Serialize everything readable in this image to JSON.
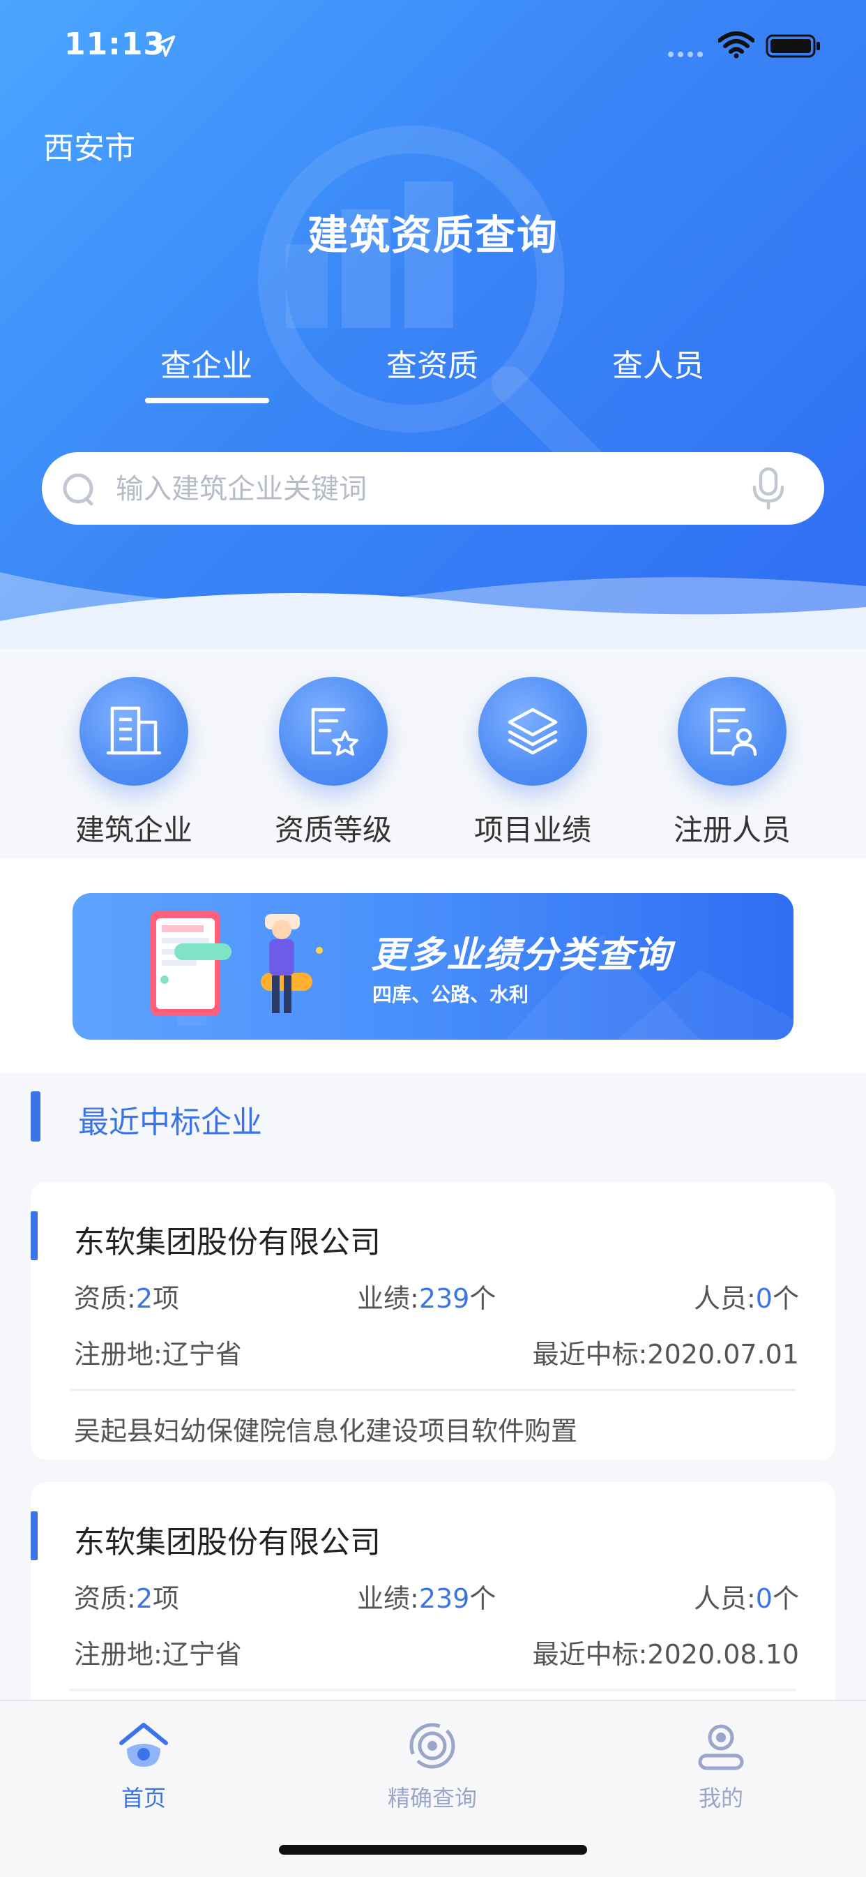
{
  "status_bar": {
    "time": "11:13"
  },
  "header": {
    "city": "西安市",
    "title": "建筑资质查询",
    "tabs": [
      {
        "label": "查企业",
        "active": true
      },
      {
        "label": "查资质",
        "active": false
      },
      {
        "label": "查人员",
        "active": false
      }
    ],
    "search": {
      "placeholder": "输入建筑企业关键词",
      "value": ""
    }
  },
  "quick_entries": [
    {
      "label": "建筑企业",
      "icon": "building-icon"
    },
    {
      "label": "资质等级",
      "icon": "certificate-star-icon"
    },
    {
      "label": "项目业绩",
      "icon": "layers-icon"
    },
    {
      "label": "注册人员",
      "icon": "person-card-icon"
    }
  ],
  "banner": {
    "title": "更多业绩分类查询",
    "subtitle": "四库、公路、水利"
  },
  "section": {
    "title": "最近中标企业"
  },
  "companies": [
    {
      "name": "东软集团股份有限公司",
      "qual_label": "资质:",
      "qual_value": "2",
      "qual_unit": "项",
      "perf_label": "业绩:",
      "perf_value": "239",
      "perf_unit": "个",
      "staff_label": "人员:",
      "staff_value": "0",
      "staff_unit": "个",
      "region": "注册地:辽宁省",
      "recent_bid": "最近中标:2020.07.01",
      "project": "吴起县妇幼保健院信息化建设项目软件购置"
    },
    {
      "name": "东软集团股份有限公司",
      "qual_label": "资质:",
      "qual_value": "2",
      "qual_unit": "项",
      "perf_label": "业绩:",
      "perf_value": "239",
      "perf_unit": "个",
      "staff_label": "人员:",
      "staff_value": "0",
      "staff_unit": "个",
      "region": "注册地:辽宁省",
      "recent_bid": "最近中标:2020.08.10",
      "project": ""
    }
  ],
  "bottom_nav": [
    {
      "label": "首页",
      "icon": "home-icon",
      "active": true
    },
    {
      "label": "精确查询",
      "icon": "precise-search-icon",
      "active": false
    },
    {
      "label": "我的",
      "icon": "profile-icon",
      "active": false
    }
  ],
  "colors": {
    "primary": "#3b73e9",
    "header_gradient_start": "#4aa6ff",
    "header_gradient_end": "#2f6ef3"
  }
}
